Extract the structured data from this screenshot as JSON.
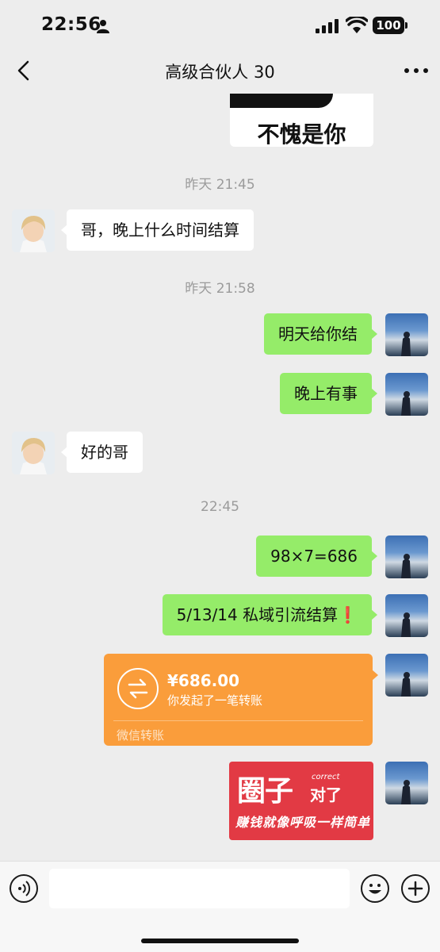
{
  "status_bar": {
    "time": "22:56",
    "battery": "100"
  },
  "header": {
    "title": "高级合伙人 30"
  },
  "messages": {
    "sticker1_text": "不愧是你",
    "ts1": "昨天 21:45",
    "m1": "哥，晚上什么时间结算",
    "ts2": "昨天 21:58",
    "m2": "明天给你结",
    "m3": "晚上有事",
    "m4": "好的哥",
    "ts3": "22:45",
    "m5": "98×7=686",
    "m6": "5/13/14 私域引流结算❗",
    "transfer": {
      "amount": "¥686.00",
      "desc": "你发起了一笔转账",
      "label": "微信转账"
    },
    "sticker2": {
      "big": "圈子",
      "correct": "correct",
      "right": "对了",
      "sub": "赚钱就像呼吸一样简单"
    }
  },
  "colors": {
    "sent_bubble": "#95ec69",
    "transfer": "#fa9d3b",
    "background": "#ededed"
  }
}
